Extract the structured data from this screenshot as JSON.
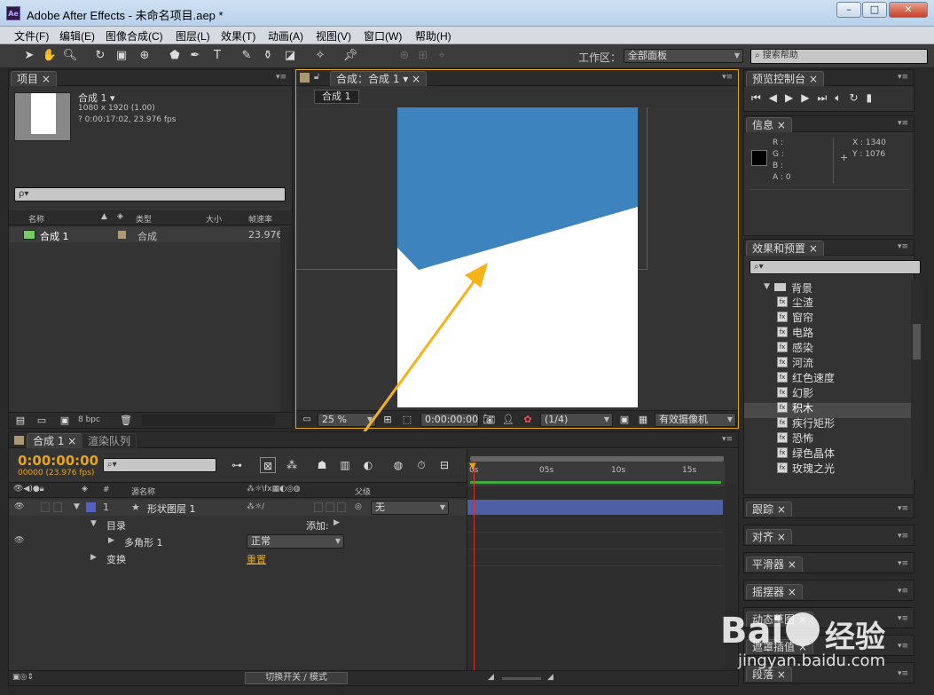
{
  "window": {
    "title": "Adobe After Effects - 未命名项目.aep *",
    "app_icon": "Ae"
  },
  "menu": [
    "文件(F)",
    "编辑(E)",
    "图像合成(C)",
    "图层(L)",
    "效果(T)",
    "动画(A)",
    "视图(V)",
    "窗口(W)",
    "帮助(H)"
  ],
  "toolbar": {
    "workspace_label": "工作区：",
    "workspace_value": "全部面板",
    "search_help": "搜索帮助"
  },
  "project": {
    "tab": "项目",
    "comp_name": "合成 1 ▾",
    "comp_size": "1080 x 1920 (1.00)",
    "comp_duration": "? 0:00:17:02, 23.976 fps",
    "search_placeholder": "ρ▾",
    "col_name": "名称",
    "col_type": "类型",
    "col_size": "大小",
    "col_fps": "帧速率",
    "item_name": "合成 1",
    "item_type": "合成",
    "item_fps": "23.976",
    "bpc": "8 bpc"
  },
  "composition": {
    "tab": "合成：合成 1",
    "subtab": "合成 1",
    "zoom": "25 %",
    "timecode": "0:00:00:00",
    "resolution": "(1/4)",
    "camera": "有效摄像机"
  },
  "timeline": {
    "tab_comp": "合成 1",
    "tab_render": "渲染队列",
    "timecode": "0:00:00:00",
    "frame_info": "00000 (23.976 fps)",
    "col_source": "源名称",
    "col_parent": "父级",
    "num_label": "#",
    "layer_num": "1",
    "layer_name": "形状图层 1",
    "parent_value": "无",
    "contents": "目录",
    "add": "添加:",
    "polygon": "多角形 1",
    "blend_mode": "正常",
    "transform": "变换",
    "reset": "重置",
    "ruler": [
      "0s",
      "05s",
      "10s",
      "15s"
    ],
    "footer_toggle": "切换开关 / 模式"
  },
  "preview": {
    "tab": "预览控制台"
  },
  "info": {
    "tab": "信息",
    "r": "R :",
    "g": "G :",
    "b": "B :",
    "a": "A : 0",
    "x": "X : 1340",
    "y": "Y : 1076"
  },
  "effects": {
    "tab": "效果和预置",
    "folder": "背景",
    "items": [
      "尘渣",
      "窗帘",
      "电路",
      "感染",
      "河流",
      "红色速度",
      "幻影",
      "积木",
      "疾行矩形",
      "恐怖",
      "绿色晶体",
      "玫瑰之光"
    ],
    "selected_index": 7
  },
  "side_panels": [
    "跟踪",
    "对齐",
    "平滑器",
    "摇摆器",
    "动态草图",
    "遮罩插值",
    "段落"
  ],
  "watermark": {
    "text1": "Bai",
    "text2": "经验",
    "url": "jingyan.baidu.com"
  },
  "colors": {
    "accent_orange": "#e8a317",
    "comp_blue": "#3d84bf",
    "layer_bar": "#4f5fa6"
  }
}
